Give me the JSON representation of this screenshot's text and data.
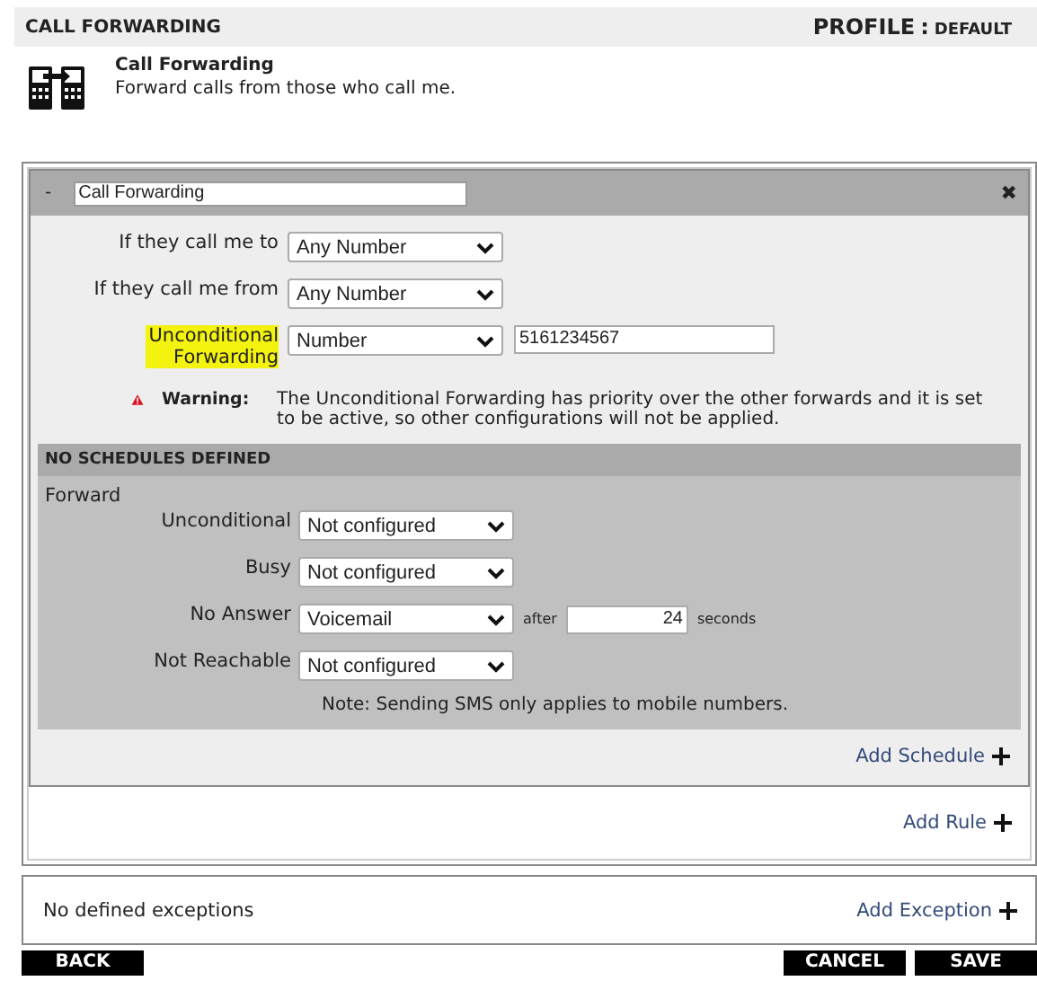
{
  "header": {
    "title": "CALL FORWARDING",
    "profile_label": "PROFILE",
    "profile_sep": ":",
    "profile_value": "DEFAULT"
  },
  "intro": {
    "title": "Call Forwarding",
    "description": "Forward calls from those who call me."
  },
  "rule": {
    "toggle": "-",
    "expanded": true,
    "name": "Call Forwarding",
    "close": "✖",
    "conditions": [
      {
        "label": "If they call me to",
        "value": "Any Number",
        "highlighted": false
      },
      {
        "label": "If they call me from",
        "value": "Any Number",
        "highlighted": false
      },
      {
        "label": "Unconditional Forwarding",
        "value": "Number",
        "number": "5161234567",
        "highlighted": true
      }
    ],
    "warning": {
      "label": "Warning:",
      "text": "The Unconditional Forwarding has priority over the other forwards and it is set to be active, so other configurations will not be applied."
    },
    "schedule": {
      "header": "NO SCHEDULES DEFINED",
      "section_label": "Forward",
      "forwards": [
        {
          "label": "Unconditional",
          "value": "Not configured"
        },
        {
          "label": "Busy",
          "value": "Not configured"
        },
        {
          "label": "No Answer",
          "value": "Voicemail",
          "after_label": "after",
          "seconds": "24",
          "unit": "seconds"
        },
        {
          "label": "Not Reachable",
          "value": "Not configured"
        }
      ],
      "note": "Note: Sending SMS only applies to mobile numbers."
    },
    "add_schedule": "Add Schedule"
  },
  "add_rule": "Add Rule",
  "exceptions": {
    "text": "No defined exceptions",
    "add": "Add Exception"
  },
  "buttons": {
    "back": "BACK",
    "cancel": "CANCEL",
    "save": "SAVE"
  }
}
